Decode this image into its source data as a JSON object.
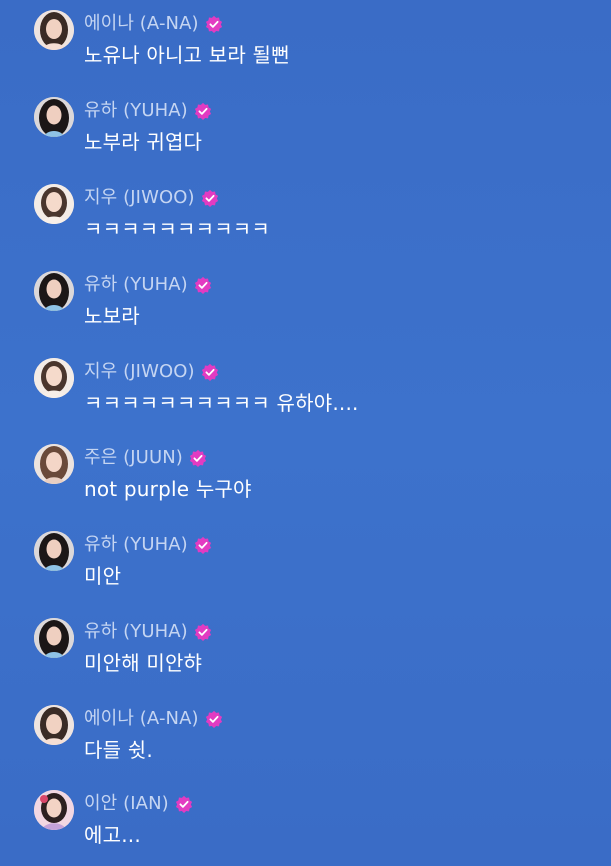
{
  "chat": {
    "background_color": "#3b6fc8",
    "verified_badge_color": "#e23bc2",
    "messages": [
      {
        "sender": "에이나 (A-NA)",
        "text": "노유나 아니고 보라 될뻔",
        "avatar": "member-avatar-a-na",
        "verified": true
      },
      {
        "sender": "유하 (YUHA)",
        "text": "노부라 귀엽다",
        "avatar": "member-avatar-yuha",
        "verified": true
      },
      {
        "sender": "지우 (JIWOO)",
        "text": "ㅋㅋㅋㅋㅋㅋㅋㅋㅋㅋ",
        "avatar": "member-avatar-jiwoo",
        "verified": true
      },
      {
        "sender": "유하 (YUHA)",
        "text": "노보라",
        "avatar": "member-avatar-yuha",
        "verified": true
      },
      {
        "sender": "지우 (JIWOO)",
        "text": "ㅋㅋㅋㅋㅋㅋㅋㅋㅋㅋ 유하야....",
        "avatar": "member-avatar-jiwoo",
        "verified": true
      },
      {
        "sender": "주은 (JUUN)",
        "text": "not purple 누구야",
        "avatar": "member-avatar-juun",
        "verified": true
      },
      {
        "sender": "유하 (YUHA)",
        "text": "미안",
        "avatar": "member-avatar-yuha",
        "verified": true
      },
      {
        "sender": "유하 (YUHA)",
        "text": "미안해 미안햐",
        "avatar": "member-avatar-yuha",
        "verified": true
      },
      {
        "sender": "에이나 (A-NA)",
        "text": "다들 쉿.",
        "avatar": "member-avatar-a-na",
        "verified": true
      },
      {
        "sender": "이안 (IAN)",
        "text": "에고...",
        "avatar": "member-avatar-ian",
        "verified": true
      }
    ]
  }
}
